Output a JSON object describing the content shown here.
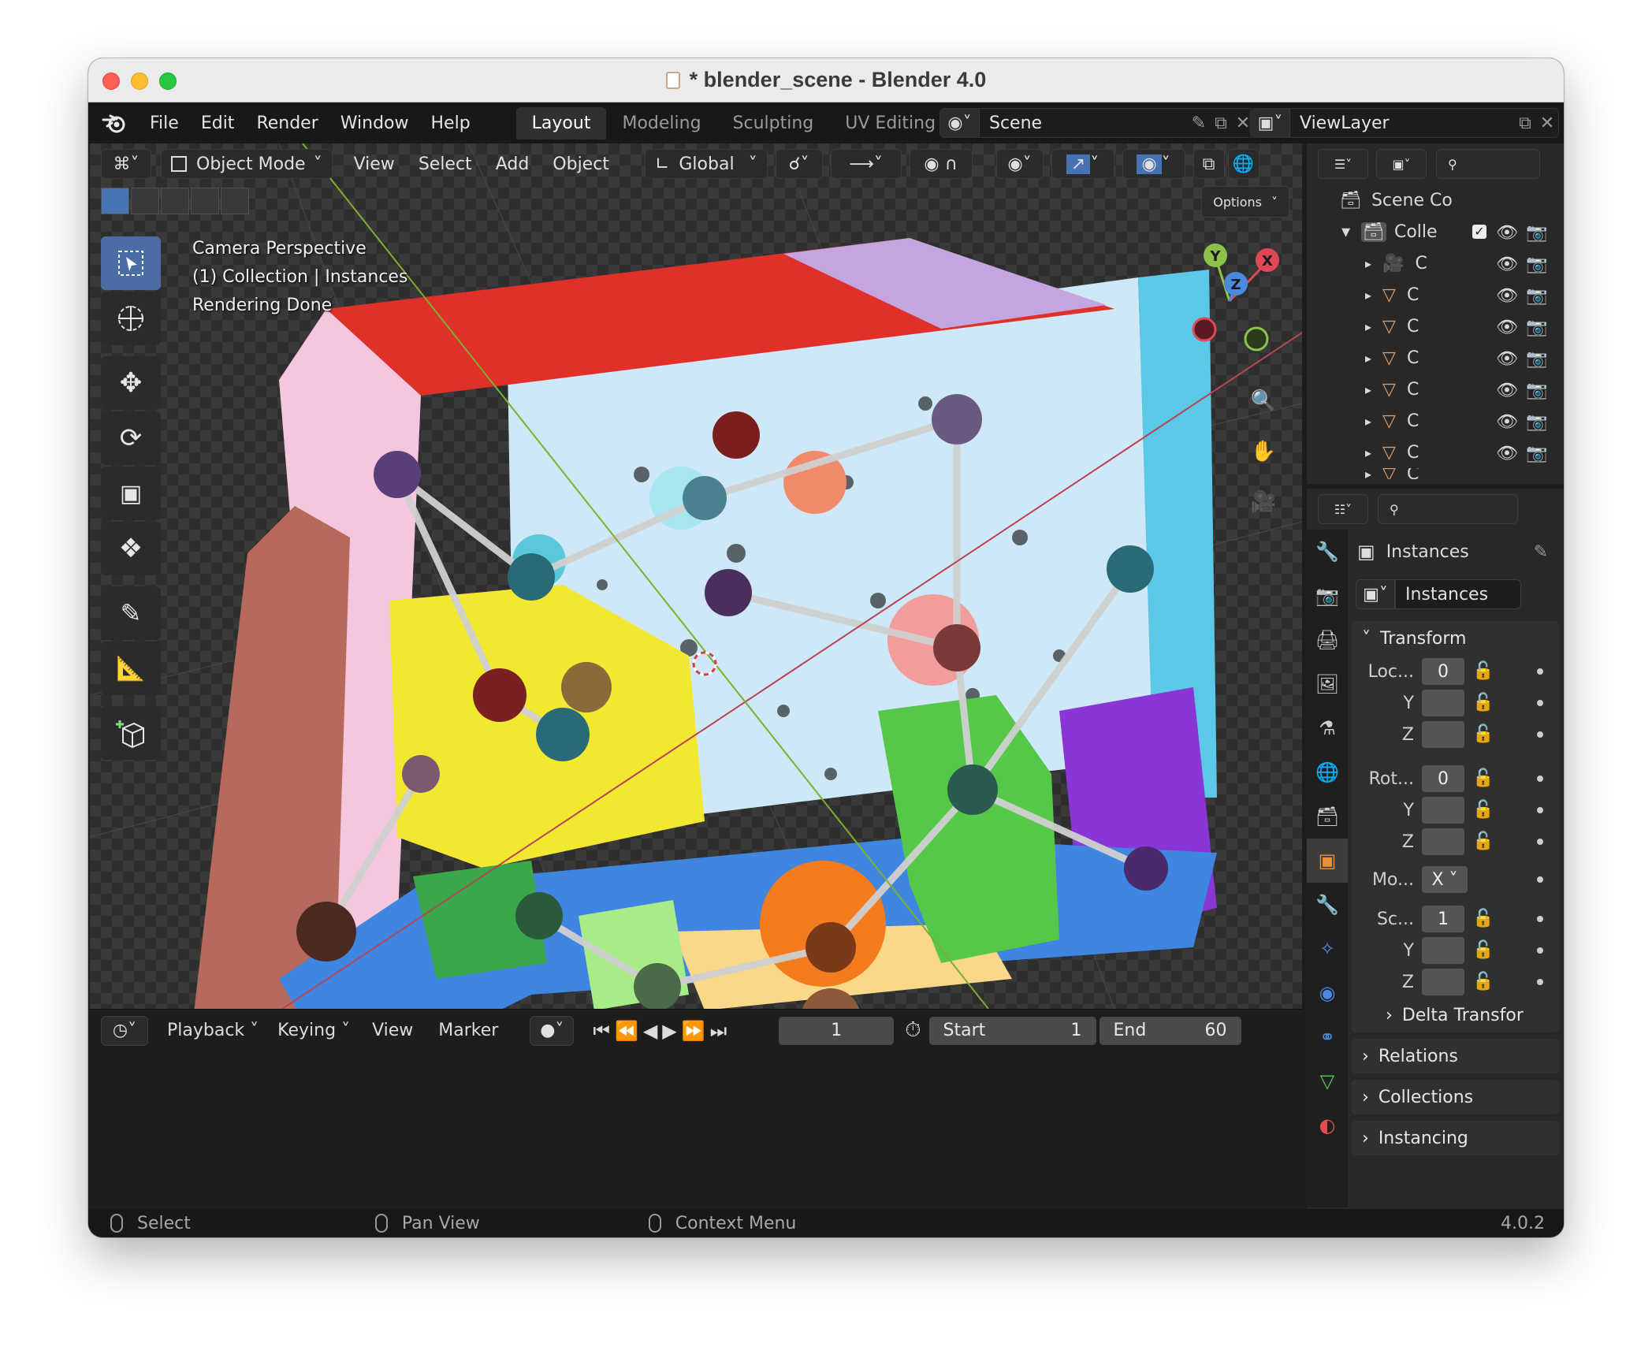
{
  "window": {
    "title": "* blender_scene - Blender 4.0"
  },
  "menu": [
    "File",
    "Edit",
    "Render",
    "Window",
    "Help"
  ],
  "workspaces": [
    {
      "label": "Layout",
      "active": true
    },
    {
      "label": "Modeling",
      "active": false
    },
    {
      "label": "Sculpting",
      "active": false
    },
    {
      "label": "UV Editing",
      "active": false
    }
  ],
  "scene": {
    "label": "Scene"
  },
  "view_layer": {
    "label": "ViewLayer"
  },
  "viewport": {
    "mode": "Object Mode",
    "menus": [
      "View",
      "Select",
      "Add",
      "Object"
    ],
    "orientation": "Global",
    "options_label": "Options",
    "overlay_lines": [
      "Camera Perspective",
      "(1) Collection | Instances",
      "Rendering Done"
    ],
    "gizmo_axes": [
      "Y",
      "X",
      "Z"
    ]
  },
  "timeline": {
    "menus": [
      "Playback",
      "Keying",
      "View",
      "Marker"
    ],
    "current_frame": "1",
    "start_label": "Start",
    "start": "1",
    "end_label": "End",
    "end": "60"
  },
  "statusbar": {
    "select": "Select",
    "pan": "Pan View",
    "context": "Context Menu",
    "version": "4.0.2"
  },
  "outliner": {
    "root": "Scene Co",
    "collection": "Colle",
    "items": [
      "C",
      "C",
      "C",
      "C",
      "C",
      "C",
      "C",
      "C"
    ]
  },
  "properties": {
    "object_name": "Instances",
    "data_name": "Instances",
    "transform": {
      "title": "Transform",
      "location_label": "Loc...",
      "location_x": "0",
      "rotation_label": "Rot...",
      "rotation_x": "0",
      "mode_label": "Mo...",
      "mode_value": "X",
      "scale_label": "Sc...",
      "scale_x": "1",
      "y_label": "Y",
      "z_label": "Z"
    },
    "delta": "Delta Transfor",
    "relations": "Relations",
    "collections": "Collections",
    "instancing": "Instancing"
  },
  "colors": {
    "accent": "#4772b3",
    "x_axis": "#e04858",
    "y_axis": "#8bc34a",
    "z_axis": "#4a8be0"
  }
}
